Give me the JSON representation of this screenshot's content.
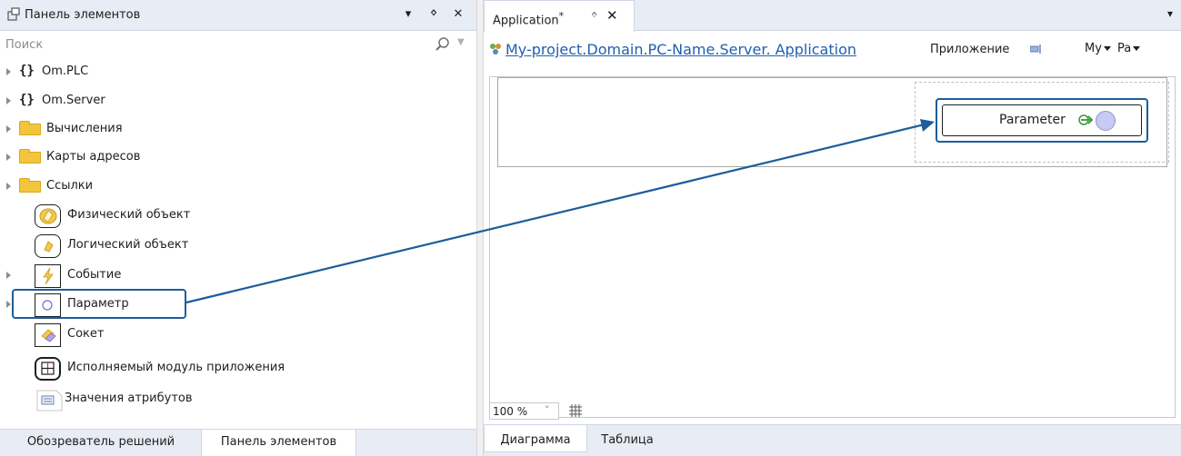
{
  "toolbox": {
    "title": "Панель элементов",
    "header_buttons": {
      "dropdown": "▾",
      "pin": "ᛜ",
      "close": "✕"
    },
    "search": {
      "placeholder": "Поиск"
    },
    "items": [
      {
        "label": "Om.PLC",
        "icon": "namespace-icon",
        "expandable": true
      },
      {
        "label": "Om.Server",
        "icon": "namespace-icon",
        "expandable": true
      },
      {
        "label": "Вычисления",
        "icon": "folder-icon",
        "expandable": true
      },
      {
        "label": "Карты адресов",
        "icon": "folder-icon",
        "expandable": true
      },
      {
        "label": "Ссылки",
        "icon": "folder-icon",
        "expandable": true
      },
      {
        "label": "Физический объект",
        "icon": "physical-object-icon",
        "expandable": false
      },
      {
        "label": "Логический объект",
        "icon": "logical-object-icon",
        "expandable": false
      },
      {
        "label": "Событие",
        "icon": "event-icon",
        "expandable": true
      },
      {
        "label": "Параметр",
        "icon": "parameter-icon",
        "expandable": true,
        "highlighted": true
      },
      {
        "label": "Сокет",
        "icon": "socket-icon",
        "expandable": false
      },
      {
        "label": "Исполняемый модуль приложения",
        "icon": "app-module-icon",
        "expandable": false
      },
      {
        "label": "Значения атрибутов",
        "icon": "attribute-values-icon",
        "expandable": false
      }
    ],
    "bottom_tabs": [
      {
        "label": "Обозреватель решений",
        "active": false
      },
      {
        "label": "Панель элементов",
        "active": true
      }
    ]
  },
  "document": {
    "tab_title": "Application",
    "tab_modified": "*",
    "tab_pin": "ᛜ",
    "tab_close": "✕",
    "tab_menu": "▾",
    "breadcrumb": "My-project.Domain.PC-Name.Server. Application",
    "type_label": "Приложение",
    "combo1": "My",
    "combo2": "Pa",
    "node_label": "Parameter",
    "zoom": "100 %",
    "zoom_caret": "˅",
    "bottom_tabs": [
      {
        "label": "Диаграмма",
        "active": true
      },
      {
        "label": "Таблица",
        "active": false
      }
    ]
  },
  "colors": {
    "highlight": "#1c5d9b",
    "folder": "#f3c53c",
    "link": "#1f5fb0",
    "param_circle": "#c7caf2"
  }
}
